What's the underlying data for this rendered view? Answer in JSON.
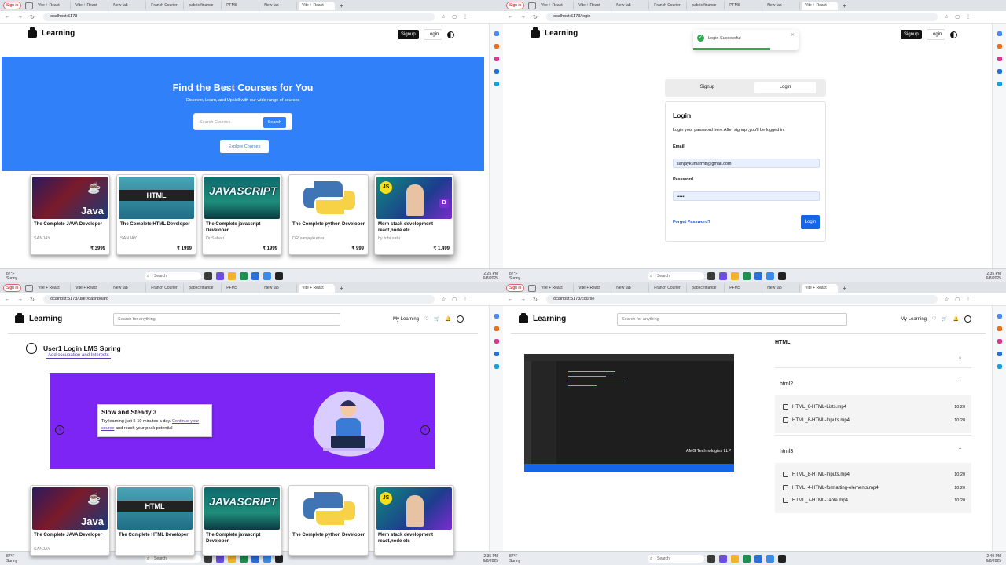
{
  "tabs": {
    "signin": "Sign in",
    "items": [
      "Vite + React",
      "Vite + React",
      "New tab",
      "Franch Courier",
      "pabric finance",
      "PFMS",
      "New tab",
      "Vite + React"
    ]
  },
  "q1": {
    "url": "localhost:5173",
    "brand": "Learning",
    "signup": "Signup",
    "login": "Login",
    "hero_title": "Find the Best Courses for You",
    "hero_sub": "Discover, Learn, and Upskill with our wide range of courses",
    "search_placeholder": "Search Courses",
    "search_btn": "Search",
    "explore_btn": "Explore Courses",
    "courses": [
      {
        "thumb": "Java",
        "title": "The Complete JAVA Developer",
        "author": "SANJAY",
        "price": "₹ 3999"
      },
      {
        "thumb": "HTML",
        "title": "The Complete HTML Developer",
        "author": "SANJAY",
        "price": "₹ 1999"
      },
      {
        "thumb": "JAVASCRIPT",
        "title": "The Complete javascript Developer",
        "author": "Dr.Sabari",
        "price": "₹ 1999"
      },
      {
        "thumb": "",
        "title": "The Complete python Developer",
        "author": "DR.sanjaykumar",
        "price": "₹ 999"
      },
      {
        "thumb": "JS",
        "title": "Mern stack development react,node etc",
        "author": "by tobi sabi",
        "price": "₹ 1,499"
      }
    ]
  },
  "q2": {
    "url": "localhost:5173/login",
    "brand": "Learning",
    "signup": "Signup",
    "login": "Login",
    "toast": "Login Successful",
    "seg_signup": "Signup",
    "seg_login": "Login",
    "card_title": "Login",
    "card_desc": "Login your password here.After signup ,you'll be logged in.",
    "email_label": "Email",
    "email_value": "sanjaykumarmtt@gmail.com",
    "password_label": "Password",
    "password_value": "•••••",
    "forgot": "Forget Password?",
    "login_btn": "Login"
  },
  "q3": {
    "url": "localhost:5173/user/dashboard",
    "brand": "Learning",
    "search_placeholder": "Search for anything",
    "my_learning": "My Learning",
    "user_name": "User1 Login LMS Spring",
    "occupation_link": "Add occupation and Interests",
    "banner_title": "Slow and Steady 3",
    "banner_text_1": "Try learning just 5-10 minutes a day.",
    "banner_link": "Continue your course",
    "banner_text_2": "and reach your peak potential",
    "courses": [
      {
        "thumb": "Java",
        "title": "The Complete JAVA Developer",
        "author": "SANJAY"
      },
      {
        "thumb": "HTML",
        "title": "The Complete HTML Developer",
        "author": ""
      },
      {
        "thumb": "JAVASCRIPT",
        "title": "The Complete javascript Developer",
        "author": ""
      },
      {
        "thumb": "",
        "title": "The Complete python Developer",
        "author": ""
      },
      {
        "thumb": "JS",
        "title": "Mern stack development react,node etc",
        "author": ""
      }
    ]
  },
  "q4": {
    "url": "localhost:5173/course",
    "brand": "Learning",
    "search_placeholder": "Search for anything",
    "my_learning": "My Learning",
    "video_watermark": "AMG Technologies LLP",
    "course_title": "HTML",
    "sections": [
      {
        "name": "",
        "lessons": []
      },
      {
        "name": "html2",
        "lessons": [
          {
            "name": "HTML_6-HTML-Lists.mp4",
            "time": "10:20"
          },
          {
            "name": "HTML_8-HTML-Inputs.mp4",
            "time": "10:20"
          }
        ]
      },
      {
        "name": "html3",
        "lessons": [
          {
            "name": "HTML_8-HTML-Inputs.mp4",
            "time": "10:20"
          },
          {
            "name": "HTML_4-HTML-formatting-elements.mp4",
            "time": "10:20"
          },
          {
            "name": "HTML_7-HTML-Table.mp4",
            "time": "10:20"
          }
        ]
      }
    ]
  },
  "taskbar": {
    "weather_temp": "87°F",
    "weather_desc": "Sunny",
    "search": "Search",
    "time_1": "2:25 PM",
    "time_2": "2:35 PM",
    "time_4": "2:40 PM",
    "date": "6/8/2025"
  },
  "colors": {
    "primary": "#2f80f9",
    "banner": "#7d25f5",
    "success": "#2fa84f",
    "link": "#1a56c8"
  }
}
